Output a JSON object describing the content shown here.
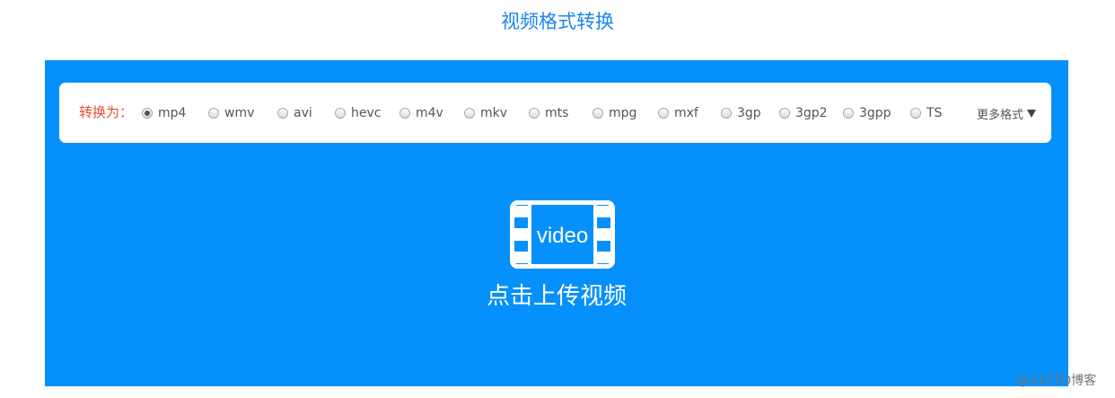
{
  "header": {
    "title": "视频格式转换"
  },
  "format_bar": {
    "label": "转换为：",
    "selected": "mp4",
    "options": [
      "mp4",
      "wmv",
      "avi",
      "hevc",
      "m4v",
      "mkv",
      "mts",
      "mpg",
      "mxf",
      "3gp",
      "3gp2",
      "3gpp",
      "TS"
    ],
    "more_label": "更多格式"
  },
  "upload": {
    "icon_text": "video",
    "label": "点击上传视频"
  },
  "watermark": "@51CTO博客",
  "colors": {
    "title": "#1a86f0",
    "panel": "#0690fb",
    "label_accent": "#ea4c2f"
  }
}
